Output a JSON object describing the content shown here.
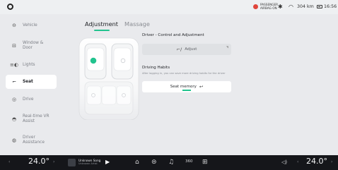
{
  "status": {
    "airbag_line1": "PASSENGER",
    "airbag_line2": "AIRBAG ON",
    "range": "304 km",
    "time": "16:56",
    "icons": [
      "airbag-warning-icon",
      "bluetooth-icon",
      "wifi-icon",
      "battery-icon"
    ]
  },
  "sidebar": {
    "items": [
      {
        "label": "Vehicle",
        "icon": "car-icon"
      },
      {
        "label": "Window & Door",
        "icon": "window-door-icon"
      },
      {
        "label": "Lights",
        "icon": "lights-icon"
      },
      {
        "label": "Seat",
        "icon": "seat-icon",
        "active": true
      },
      {
        "label": "Drive",
        "icon": "steering-wheel-icon"
      },
      {
        "label": "Real-time VR Assist",
        "icon": "vr-assist-icon"
      },
      {
        "label": "Driver Assistance",
        "icon": "driver-assistance-icon"
      }
    ]
  },
  "tabs": {
    "adjustment": "Adjustment",
    "massage": "Massage",
    "active": "adjustment",
    "accent_color": "#22c38e"
  },
  "panel": {
    "control_title": "Driver - Control and Adjustment",
    "adjust_label": "Adjust",
    "habits_title": "Driving Habits",
    "habits_desc": "After logging in, you can save more driving habits for the driver",
    "memory_label": "Seat memory"
  },
  "dock": {
    "temp_left": "24.0°",
    "temp_right": "24.0°",
    "music_title": "Unknown Song",
    "music_artist": "Unknown Artist",
    "view_360": "360",
    "icons": [
      "home-icon",
      "car-icon",
      "music-icon",
      "360-view-icon",
      "apps-grid-icon",
      "volume-icon"
    ]
  }
}
